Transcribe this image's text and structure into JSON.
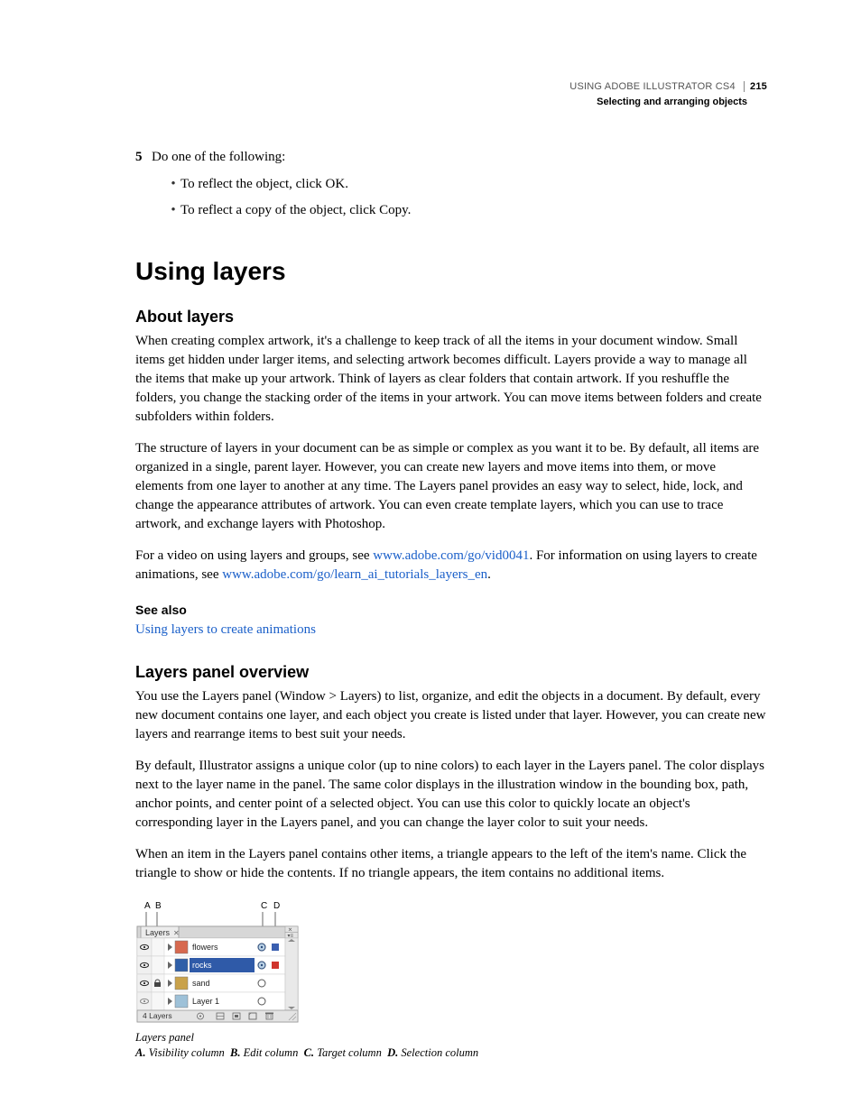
{
  "header": {
    "product": "USING ADOBE ILLUSTRATOR CS4",
    "page_number": "215",
    "section": "Selecting and arranging objects"
  },
  "step": {
    "number": "5",
    "text": "Do one of the following:",
    "bullets": [
      "To reflect the object, click OK.",
      "To reflect a copy of the object, click Copy."
    ]
  },
  "chapter_title": "Using layers",
  "about": {
    "heading": "About layers",
    "p1": "When creating complex artwork, it's a challenge to keep track of all the items in your document window. Small items get hidden under larger items, and selecting artwork becomes difficult. Layers provide a way to manage all the items that make up your artwork. Think of layers as clear folders that contain artwork. If you reshuffle the folders, you change the stacking order of the items in your artwork. You can move items between folders and create subfolders within folders.",
    "p2": "The structure of layers in your document can be as simple or complex as you want it to be. By default, all items are organized in a single, parent layer. However, you can create new layers and move items into them, or move elements from one layer to another at any time. The Layers panel provides an easy way to select, hide, lock, and change the appearance attributes of artwork. You can even create template layers, which you can use to trace artwork, and exchange layers with Photoshop.",
    "p3_a": "For a video on using layers and groups, see ",
    "p3_link1": "www.adobe.com/go/vid0041",
    "p3_b": ". For information on using layers to create animations, see ",
    "p3_link2": "www.adobe.com/go/learn_ai_tutorials_layers_en",
    "p3_c": ".",
    "seealso_label": "See also",
    "seealso_link": "Using layers to create animations"
  },
  "overview": {
    "heading": "Layers panel overview",
    "p1": "You use the Layers panel (Window > Layers) to list, organize, and edit the objects in a document. By default, every new document contains one layer, and each object you create is listed under that layer. However, you can create new layers and rearrange items to best suit your needs.",
    "p2": "By default, Illustrator assigns a unique color (up to nine colors) to each layer in the Layers panel. The color displays next to the layer name in the panel. The same color displays in the illustration window in the bounding box, path, anchor points, and center point of a selected object. You can use this color to quickly locate an object's corresponding layer in the Layers panel, and you can change the layer color to suit your needs.",
    "p3": "When an item in the Layers panel contains other items, a triangle appears to the left of the item's name. Click the triangle to show or hide the contents. If no triangle appears, the item contains no additional items."
  },
  "panel": {
    "callouts": {
      "A": "A",
      "B": "B",
      "C": "C",
      "D": "D"
    },
    "tab_label": "Layers",
    "rows": [
      {
        "name": "flowers",
        "selected": false,
        "locked": false,
        "template": false,
        "target_filled": true,
        "sel_color": "#3a5fb0"
      },
      {
        "name": "rocks",
        "selected": true,
        "locked": false,
        "template": false,
        "target_filled": true,
        "sel_color": "#d0342c"
      },
      {
        "name": "sand",
        "selected": false,
        "locked": true,
        "template": false,
        "target_filled": false,
        "sel_color": ""
      },
      {
        "name": "Layer 1",
        "selected": false,
        "locked": false,
        "template": true,
        "target_filled": false,
        "sel_color": ""
      }
    ],
    "status": "4 Layers"
  },
  "caption": "Layers panel",
  "legend": {
    "A": "Visibility column",
    "B": "Edit column",
    "C": "Target column",
    "D": "Selection column"
  }
}
